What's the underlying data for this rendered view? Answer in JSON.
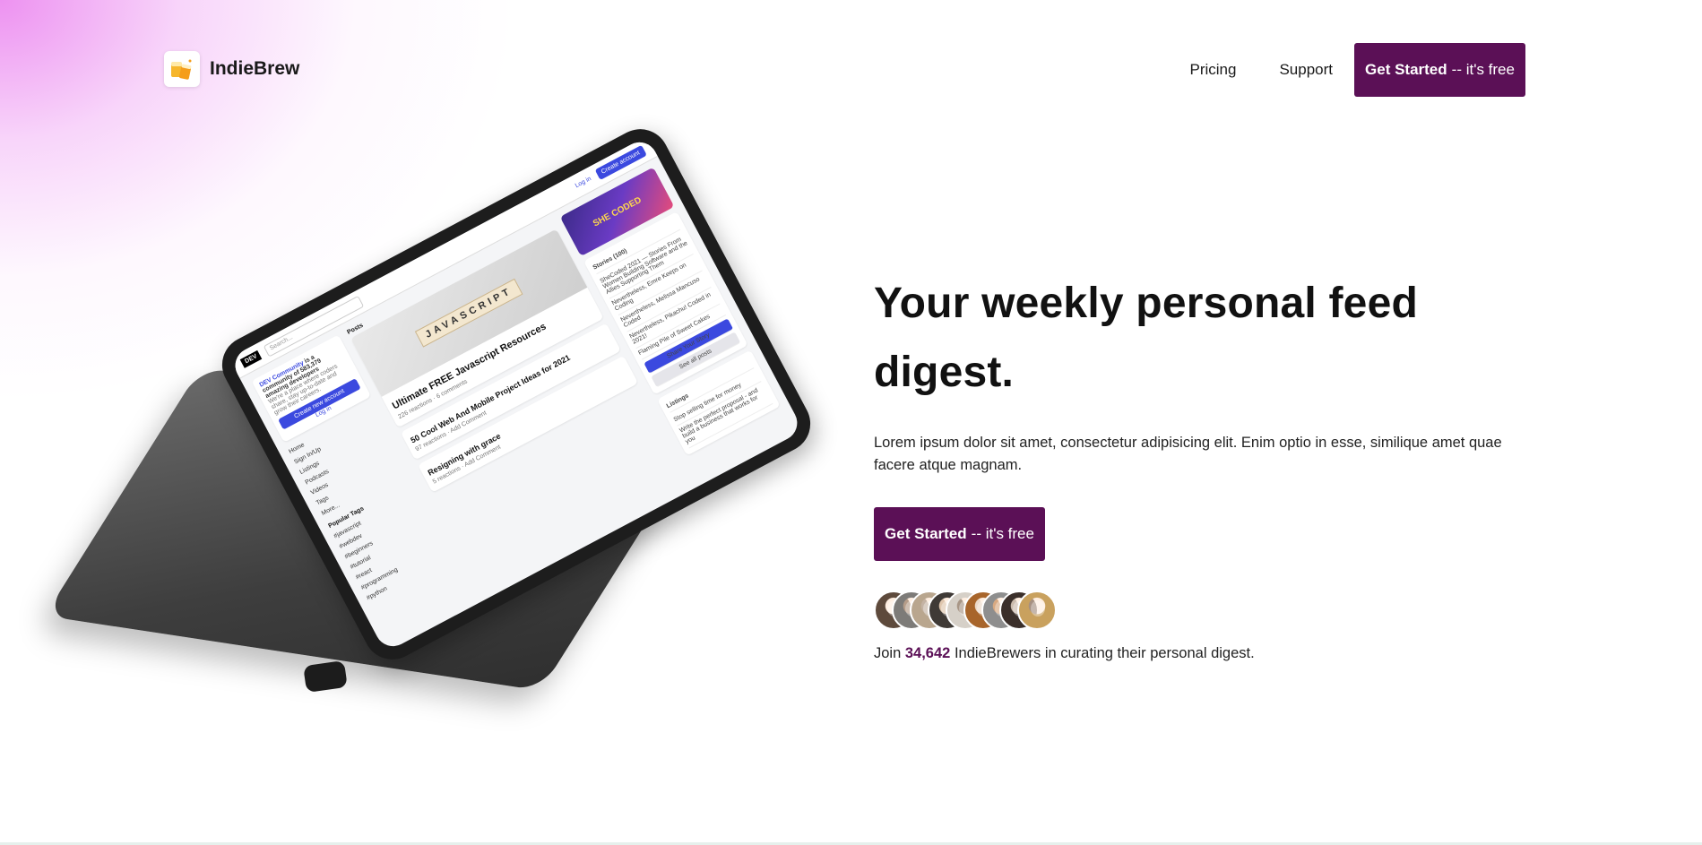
{
  "header": {
    "logo_text": "IndieBrew",
    "nav": {
      "pricing": "Pricing",
      "support": "Support"
    },
    "cta": {
      "bold": "Get Started",
      "rest": "-- it's free"
    }
  },
  "hero": {
    "headline": "Your weekly personal feed digest.",
    "lead": "Lorem ipsum dolor sit amet, consectetur adipisicing elit. Enim optio in esse, similique amet quae facere atque magnam.",
    "cta": {
      "bold": "Get Started",
      "rest": "-- it's free"
    },
    "join": {
      "prefix": "Join",
      "count": "34,642",
      "suffix": "IndieBrewers in curating their personal digest."
    }
  },
  "device_screen": {
    "logo": "DEV",
    "search_placeholder": "Search...",
    "login": "Log in",
    "create_account": "Create account",
    "community_title": "DEV Community",
    "community_rest": "is a community of 583,379 amazing developers",
    "community_desc": "We're a place where coders share, stay up-to-date and grow their careers.",
    "create_btn": "Create new account",
    "login_link": "Log in",
    "left_nav": [
      "Home",
      "Sign In/Up",
      "Listings",
      "Podcasts",
      "Videos",
      "Tags",
      "More..."
    ],
    "popular_tags_title": "Popular Tags",
    "popular_tags": [
      "#javascript",
      "#webdev",
      "#beginners",
      "#tutorial",
      "#react",
      "#programming",
      "#python"
    ],
    "posts_title": "Posts",
    "image_word": "JAVASCRIPT",
    "post1_title": "Ultimate FREE Javascript Resources",
    "post1_meta": "226 reactions · 6 comments",
    "post2_title": "50 Cool Web And Mobile Project Ideas for 2021",
    "post2_meta": "97 reactions · Add Comment",
    "post3_title": "Resigning with grace",
    "post3_meta": "5 reactions · Add Comment",
    "stories_title": "Stories (100)",
    "stories": [
      "SheCoded 2021 — Stories From Women Building Software and the Allies Supporting Them",
      "Nevertheless, Emre Keeps on Coding",
      "Nevertheless, Melissa Mancuso Coded",
      "Nevertheless, Pikachu! Coded in 2021!",
      "Flaming Pile of Sweet Cakes"
    ],
    "share_btn": "Share Your Story",
    "see_all": "See all posts",
    "listings_title": "Listings",
    "listings": [
      "Stop selling time for money",
      "Write the perfect proposal - and build a business that works for you"
    ],
    "banner": "SHE CODED"
  },
  "colors": {
    "accent": "#5b1056",
    "dev_blue": "#3b49df"
  },
  "avatars": [
    "#5e4a3c",
    "#7d7b78",
    "#b9a68e",
    "#3f3a36",
    "#d6d0c8",
    "#a8652b",
    "#8e8e8e",
    "#3b2f2a",
    "#c9a15e"
  ]
}
